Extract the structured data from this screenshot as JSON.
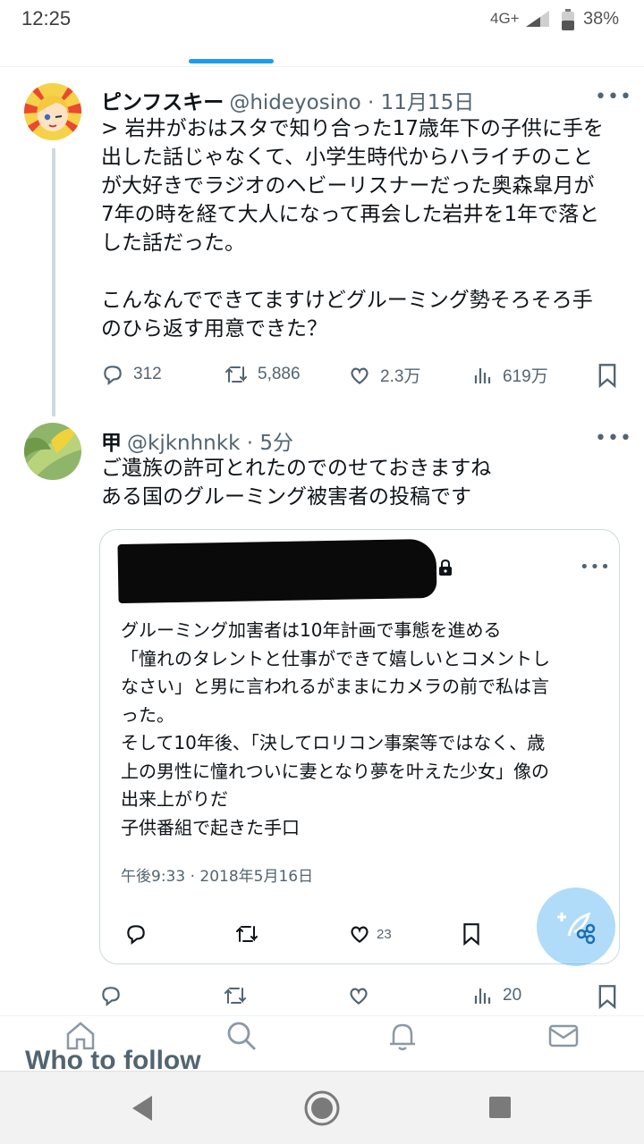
{
  "status_bar": {
    "time": "12:25",
    "network": "4G+",
    "battery": "38%"
  },
  "tweet1": {
    "display_name": "ピンフスキー",
    "handle_date": "@hideyosino · 11月15日",
    "text": "> 岩井がおはスタで知り合った17歳年下の子供に手を\n出した話じゃなくて、小学生時代からハライチのこと\nが大好きでラジオのヘビーリスナーだった奥森皐月が\n7年の時を経て大人になって再会した岩井を1年で落と\nした話だった。\n\nこんなんでできてますけどグルーミング勢そろそろ手\nのひら返す用意できた？",
    "replies": "312",
    "retweets": "5,886",
    "likes": "2.3万",
    "views": "619万"
  },
  "tweet2": {
    "display_name": "甲",
    "handle_date": "@kjknhnkk · 5分",
    "text": "ご遺族の許可とれたのでのせておきますね\nある国のグルーミング被害者の投稿です",
    "views": "20"
  },
  "quoted": {
    "text": "グルーミング加害者は10年計画で事態を進める\n「憧れのタレントと仕事ができて嬉しいとコメントし\nなさい」と男に言われるがままにカメラの前で私は言\nった。\nそして10年後、「決してロリコン事案等ではなく、歳\n上の男性に憧れついに妻となり夢を叶えた少女」像の\n出来上がりだ\n子供番組で起きた手口",
    "date": "午後9:33 · 2018年5月16日",
    "likes": "23"
  },
  "who_to_follow": "Who to follow",
  "icons": {
    "more": "more-icon",
    "reply": "reply-icon",
    "retweet": "retweet-icon",
    "like": "like-icon",
    "views": "views-icon",
    "bookmark": "bookmark-icon",
    "compose": "compose-icon",
    "home": "home-icon",
    "search": "search-icon",
    "notifications": "bell-icon",
    "messages": "mail-icon"
  },
  "colors": {
    "accent": "#1d9bf0",
    "muted": "#536471",
    "text": "#0f1419"
  }
}
